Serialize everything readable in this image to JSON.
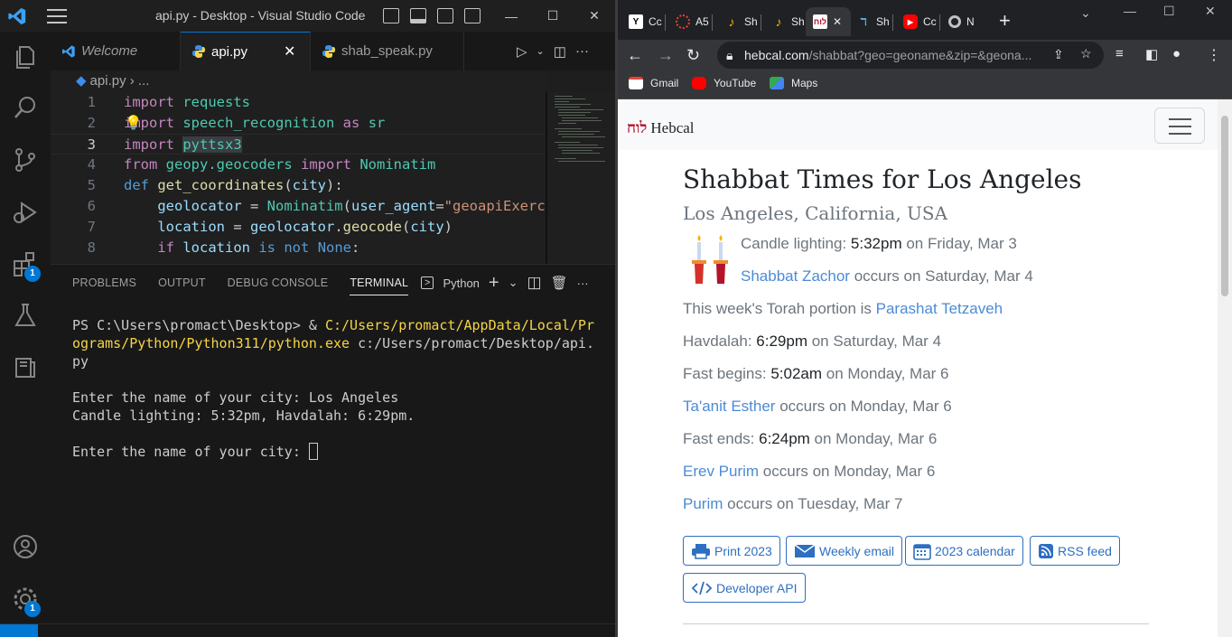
{
  "vscode": {
    "window_title": "api.py - Desktop - Visual Studio Code",
    "tabs": [
      {
        "label": "Welcome"
      },
      {
        "label": "api.py",
        "close": "✕"
      },
      {
        "label": "shab_speak.py"
      }
    ],
    "breadcrumb": {
      "file": "api.py",
      "sep": "› ..."
    },
    "code_lines": [
      {
        "n": "1"
      },
      {
        "n": "2"
      },
      {
        "n": "3"
      },
      {
        "n": "4"
      },
      {
        "n": "5"
      },
      {
        "n": "6"
      },
      {
        "n": "7"
      },
      {
        "n": "8"
      }
    ],
    "panel": {
      "tabs": [
        "PROBLEMS",
        "OUTPUT",
        "DEBUG CONSOLE",
        "TERMINAL"
      ],
      "active_tab": "TERMINAL",
      "shell": "Python"
    },
    "terminal": {
      "prompt": "PS C:\\Users\\promact\\Desktop> & ",
      "exe_path_1": "C:/Users/promact/AppData/Local/Pr",
      "exe_path_2": "ograms/Python/Python311/python.exe",
      "script_path_2": " c:/Users/promact/Desktop/api.",
      "script_path_3": "py",
      "line_city": "Enter the name of your city: Los Angeles",
      "line_times": "Candle lighting: 5:32pm, Havdalah: 6:29pm.",
      "line_prompt": "Enter the name of your city: "
    },
    "badges": {
      "extensions": "1",
      "settings": "1"
    }
  },
  "chrome": {
    "tabs": [
      {
        "label": "Cc",
        "icon": "y-icon"
      },
      {
        "label": "A5",
        "icon": "spinner-icon"
      },
      {
        "label": "Sh",
        "icon": "flame-icon"
      },
      {
        "label": "Sh",
        "icon": "flame-icon"
      },
      {
        "label": "",
        "icon": "hebcal-icon"
      },
      {
        "label": "Sh",
        "icon": "hebrew-icon"
      },
      {
        "label": "Cc",
        "icon": "youtube-icon"
      },
      {
        "label": "N",
        "icon": "chrome-icon"
      }
    ],
    "active_tab_close": "✕",
    "url_host": "hebcal.com",
    "url_rest": "/shabbat?geo=geoname&zip=&geona...",
    "bookmarks": [
      "Gmail",
      "YouTube",
      "Maps"
    ]
  },
  "page": {
    "brand_hebrew": "לוח",
    "brand": "Hebcal",
    "title": "Shabbat Times for Los Angeles",
    "subtitle": "Los Angeles, California, USA",
    "candle": {
      "label": "Candle lighting: ",
      "time": "5:32pm",
      "rest": " on Friday, Mar 3"
    },
    "zachor": {
      "link": "Shabbat Zachor",
      "rest": " occurs on Saturday, Mar 4"
    },
    "torah": {
      "label": "This week's Torah portion is ",
      "link": "Parashat Tetzaveh"
    },
    "havdalah": {
      "label": "Havdalah: ",
      "time": "6:29pm",
      "rest": " on Saturday, Mar 4"
    },
    "fast_begins": {
      "label": "Fast begins: ",
      "time": "5:02am",
      "rest": " on Monday, Mar 6"
    },
    "esther": {
      "link": "Ta'anit Esther",
      "rest": " occurs on Monday, Mar 6"
    },
    "fast_ends": {
      "label": "Fast ends: ",
      "time": "6:24pm",
      "rest": " on Monday, Mar 6"
    },
    "erev_purim": {
      "link": "Erev Purim",
      "rest": " occurs on Monday, Mar 6"
    },
    "purim": {
      "link": "Purim",
      "rest": " occurs on Tuesday, Mar 7"
    },
    "buttons": {
      "print": "Print 2023",
      "email": "Weekly email",
      "calendar": "2023 calendar",
      "rss": "RSS feed",
      "api": "Developer API"
    }
  }
}
